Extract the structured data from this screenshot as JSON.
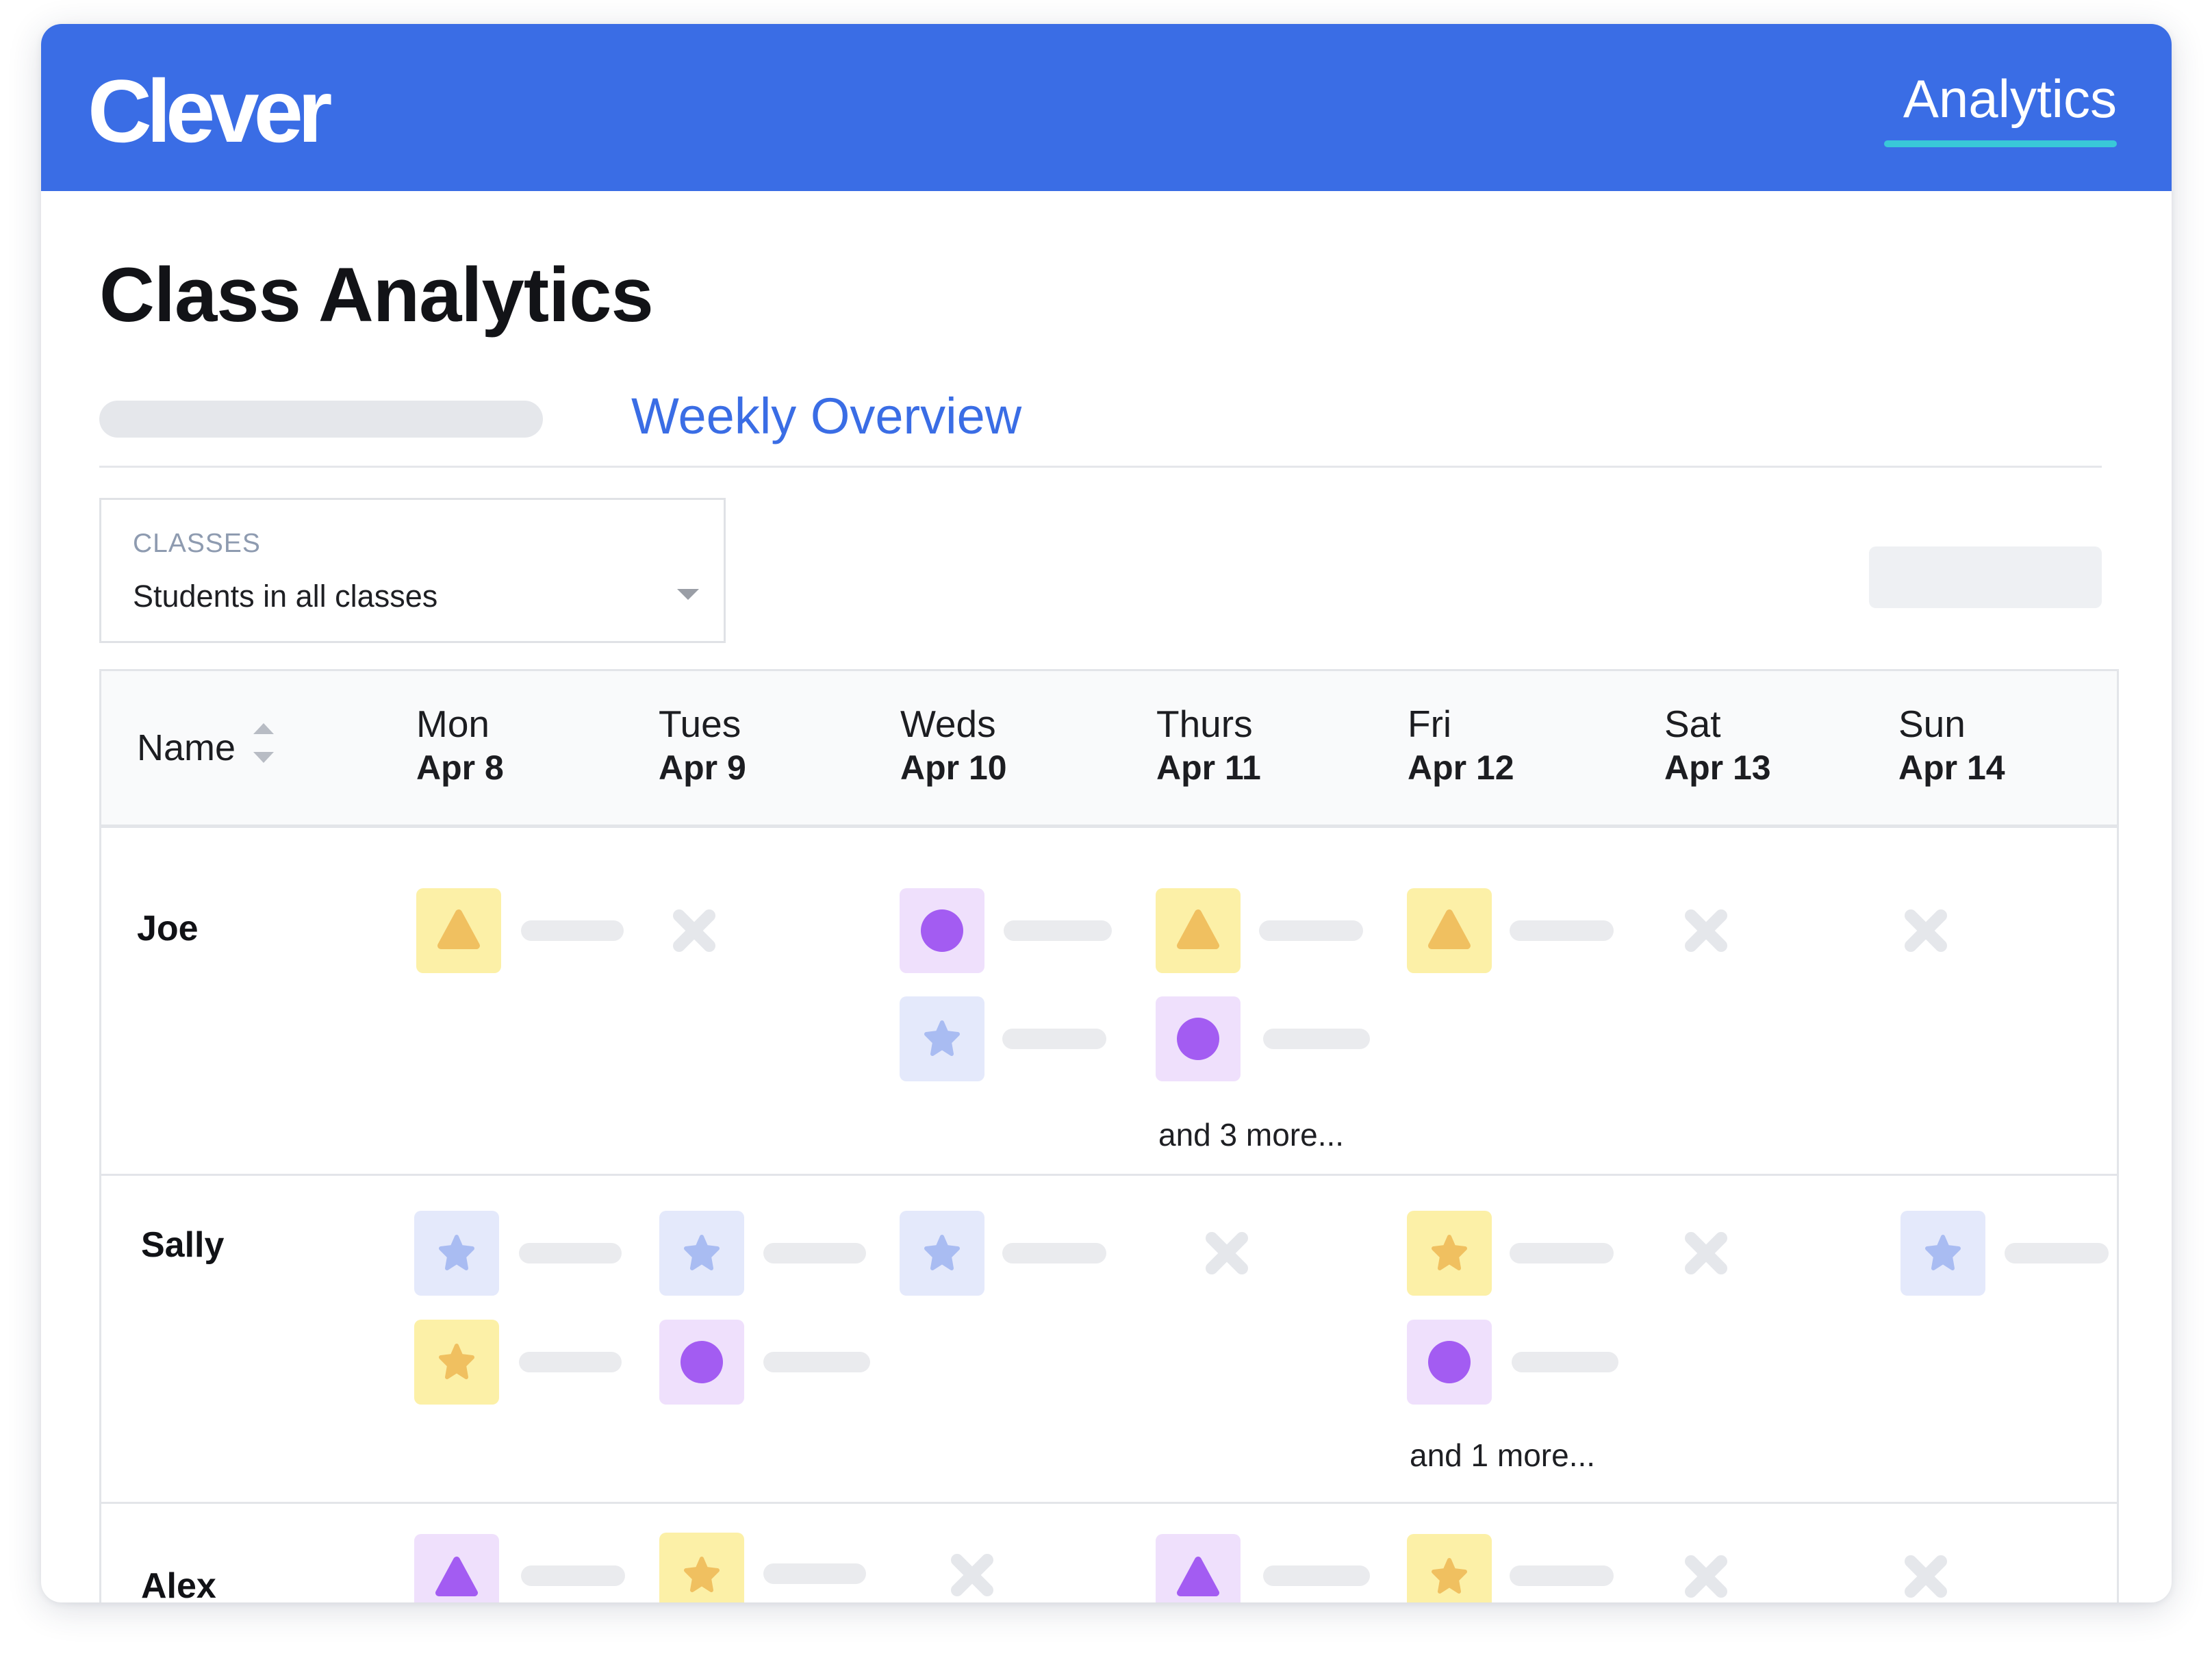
{
  "header": {
    "logo": "Clever",
    "nav_active": "Analytics"
  },
  "page": {
    "title": "Class Analytics",
    "active_tab": "Weekly Overview"
  },
  "filter": {
    "label": "CLASSES",
    "value": "Students in all classes"
  },
  "table": {
    "name_header": "Name",
    "days": [
      {
        "day": "Mon",
        "date": "Apr 8"
      },
      {
        "day": "Tues",
        "date": "Apr 9"
      },
      {
        "day": "Weds",
        "date": "Apr 10"
      },
      {
        "day": "Thurs",
        "date": "Apr 11"
      },
      {
        "day": "Fri",
        "date": "Apr 12"
      },
      {
        "day": "Sat",
        "date": "Apr 13"
      },
      {
        "day": "Sun",
        "date": "Apr 14"
      }
    ],
    "students": [
      {
        "name": "Joe",
        "more": {
          "thu": "and 3 more..."
        }
      },
      {
        "name": "Sally",
        "more": {
          "fri": "and 1 more..."
        }
      },
      {
        "name": "Alex"
      }
    ]
  },
  "colors": {
    "brand_blue": "#3a6de5",
    "yellow_tile": "#fcf0a7",
    "yellow_icon": "#f0c060",
    "purple_tile": "#efe0fc",
    "purple_icon": "#a35cf2",
    "blue_tile": "#e4e9fb",
    "blue_icon": "#a9bcf2",
    "absent_icon": "#e5e7eb"
  },
  "icons": {
    "yellow_triangle": "yellow-triangle-icon",
    "yellow_star": "yellow-star-icon",
    "purple_circle": "purple-circle-icon",
    "purple_triangle": "purple-triangle-icon",
    "blue_star": "blue-star-icon",
    "absent": "x-mark-icon"
  }
}
